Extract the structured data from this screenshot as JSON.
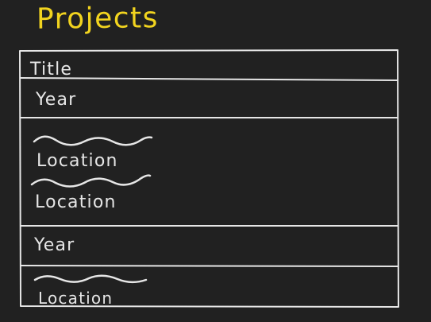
{
  "page": {
    "title": "Projects"
  },
  "rows": [
    {
      "label": "Title"
    },
    {
      "label": "Year"
    },
    {
      "label": "Location"
    },
    {
      "label": "Location"
    },
    {
      "label": "Year"
    },
    {
      "label": "Location"
    }
  ],
  "colors": {
    "background": "#212121",
    "title": "#f2d41f",
    "ink": "#e6e6e6"
  }
}
